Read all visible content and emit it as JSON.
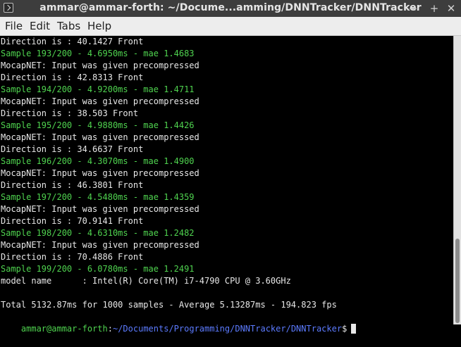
{
  "window": {
    "title": "ammar@ammar-forth: ~/Docume...amming/DNNTracker/DNNTracker",
    "minimize_glyph": "−",
    "maximize_glyph": "+",
    "close_glyph": "✕",
    "icon": "terminal-icon"
  },
  "menu": {
    "file": "File",
    "edit": "Edit",
    "tabs": "Tabs",
    "help": "Help"
  },
  "terminal": {
    "lines": [
      {
        "text": "Direction is : 40.1427 Front",
        "color": "white"
      },
      {
        "text": "Sample 193/200 - 4.6950ms - mae 1.4683",
        "color": "green"
      },
      {
        "text": "MocapNET: Input was given precompressed",
        "color": "white"
      },
      {
        "text": "Direction is : 42.8313 Front",
        "color": "white"
      },
      {
        "text": "Sample 194/200 - 4.9200ms - mae 1.4711",
        "color": "green"
      },
      {
        "text": "MocapNET: Input was given precompressed",
        "color": "white"
      },
      {
        "text": "Direction is : 38.503 Front",
        "color": "white"
      },
      {
        "text": "Sample 195/200 - 4.9880ms - mae 1.4426",
        "color": "green"
      },
      {
        "text": "MocapNET: Input was given precompressed",
        "color": "white"
      },
      {
        "text": "Direction is : 34.6637 Front",
        "color": "white"
      },
      {
        "text": "Sample 196/200 - 4.3070ms - mae 1.4900",
        "color": "green"
      },
      {
        "text": "MocapNET: Input was given precompressed",
        "color": "white"
      },
      {
        "text": "Direction is : 46.3801 Front",
        "color": "white"
      },
      {
        "text": "Sample 197/200 - 4.5480ms - mae 1.4359",
        "color": "green"
      },
      {
        "text": "MocapNET: Input was given precompressed",
        "color": "white"
      },
      {
        "text": "Direction is : 70.9141 Front",
        "color": "white"
      },
      {
        "text": "Sample 198/200 - 4.6310ms - mae 1.2482",
        "color": "green"
      },
      {
        "text": "MocapNET: Input was given precompressed",
        "color": "white"
      },
      {
        "text": "Direction is : 70.4886 Front",
        "color": "white"
      },
      {
        "text": "Sample 199/200 - 6.0780ms - mae 1.2491",
        "color": "green"
      },
      {
        "text": "model name      : Intel(R) Core(TM) i7-4790 CPU @ 3.60GHz",
        "color": "white"
      },
      {
        "text": "",
        "color": "white"
      },
      {
        "text": "Total 5132.87ms for 1000 samples - Average 5.13287ms - 194.823 fps",
        "color": "white"
      }
    ],
    "prompt": {
      "user_host": "ammar@ammar-forth",
      "separator": ":",
      "path": "~/Documents/Programming/DNNTracker/DNNTracker",
      "symbol": "$"
    }
  },
  "colors": {
    "green": "#4fd34f",
    "white": "#e8e8e8",
    "path_blue": "#5c7bff",
    "background": "#000000"
  }
}
